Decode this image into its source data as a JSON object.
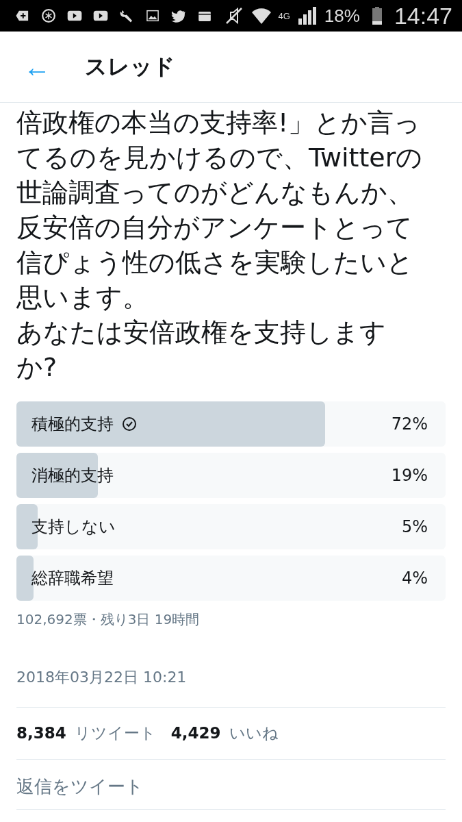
{
  "status_bar": {
    "battery_text": "18%",
    "time": "14:47",
    "network": "4G"
  },
  "header": {
    "back": "←",
    "title": "スレッド"
  },
  "tweet": {
    "lines": [
      "倍政権の本当の支持率!」とか言っ",
      "てるのを見かけるので、Twitterの",
      "世論調査ってのがどんなもんか、",
      "反安倍の自分がアンケートとって",
      "信ぴょう性の低さを実験したいと",
      "思います。",
      "あなたは安倍政権を支持します",
      "か?"
    ]
  },
  "poll": {
    "options": [
      {
        "label": "積極的支持",
        "percent": "72%",
        "level": 0.72,
        "selected": true
      },
      {
        "label": "消極的支持",
        "percent": "19%",
        "level": 0.19,
        "selected": false
      },
      {
        "label": "支持しない",
        "percent": "5%",
        "level": 0.05,
        "selected": false
      },
      {
        "label": "総辞職希望",
        "percent": "4%",
        "level": 0.04,
        "selected": false
      }
    ],
    "meta": "102,692票・残り3日 19時間"
  },
  "timestamp": "2018年03月22日 10:21",
  "stats": [
    {
      "count": "8,384",
      "label": "リツイート"
    },
    {
      "count": "4,429",
      "label": "いいね"
    }
  ],
  "reply": {
    "placeholder": "返信をツイート"
  }
}
